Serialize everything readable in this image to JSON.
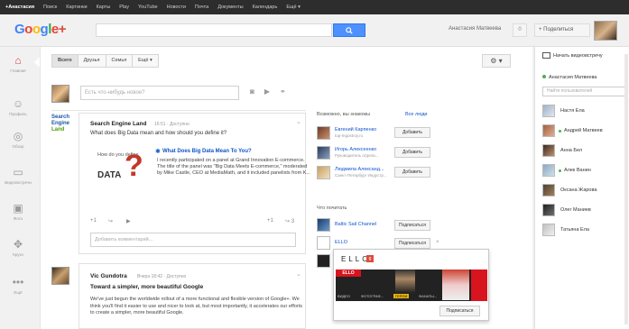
{
  "topbar": {
    "items": [
      {
        "label": "+Анастасия",
        "active": true
      },
      {
        "label": "Поиск"
      },
      {
        "label": "Картинки"
      },
      {
        "label": "Карты"
      },
      {
        "label": "Play"
      },
      {
        "label": "YouTube"
      },
      {
        "label": "Новости"
      },
      {
        "label": "Почта"
      },
      {
        "label": "Документы"
      },
      {
        "label": "Календарь"
      },
      {
        "label": "Ещё ▾"
      }
    ]
  },
  "header": {
    "logo": "Google+",
    "user_name": "Анастасия Матвеева",
    "notifications": "0",
    "share_label": "+ Поделиться"
  },
  "leftnav": {
    "items": [
      {
        "label": "Главная",
        "icon": "home-icon",
        "glyph": "⌂"
      },
      {
        "label": "Профиль",
        "icon": "profile-icon",
        "glyph": "☺"
      },
      {
        "label": "Обзор",
        "icon": "explore-icon",
        "glyph": "◎"
      },
      {
        "label": "Видеовстречи",
        "icon": "hangouts-icon",
        "glyph": "▭"
      },
      {
        "label": "Фото",
        "icon": "photos-icon",
        "glyph": "▣"
      },
      {
        "label": "Круги",
        "icon": "circles-icon",
        "glyph": "✥"
      },
      {
        "label": "Ещё",
        "icon": "more-icon",
        "glyph": "•••"
      }
    ]
  },
  "stream": {
    "tabs": [
      {
        "label": "Всего",
        "active": true
      },
      {
        "label": "Друзья"
      },
      {
        "label": "Семья"
      },
      {
        "label": "Ещё ▾"
      }
    ],
    "gear_label": "⚙ ▾",
    "share_placeholder": "Есть что-нибудь новое?"
  },
  "post1": {
    "logo_lines": [
      "Search",
      "Engine",
      "Land"
    ],
    "author": "Search Engine Land",
    "meta": "16:51 · Доступно",
    "text": "What does Big Data mean and how should you define it?",
    "link": {
      "thumb_how": "How do you define",
      "thumb_data": "DATA",
      "title": "What Does Big Data Mean To You?",
      "desc": "I recently participated on a panel at Grand Innovation E-commerce. The title of the panel was \"Big Data Meets E-commerce,\" moderated by Mike Castle, CEO at MediaMath, and it included panelists from K..."
    },
    "actions": {
      "plus": "+1",
      "share": "↪",
      "video": "▶",
      "plus_count": "+1",
      "share_count": "↪ 3"
    },
    "comment_placeholder": "Добавить комментарий..."
  },
  "post2": {
    "author": "Vic Gundotra",
    "meta": "Вчера 18:42 · Доступно",
    "title": "Toward a simpler, more beautiful Google",
    "text": "We've just begun the worldwide rollout of a more functional and flexible version of Google+. We think you'll find it easier to use and nicer to look at, but most importantly, it accelerates our efforts to create a simpler, more beautiful Google."
  },
  "suggestions": {
    "heading": "Возможно, вы знакомы",
    "see_all": "Все люди",
    "people": [
      {
        "name": "Евгений Карпенко",
        "sub": "top-Ingostroy.ru",
        "button": "Добавить"
      },
      {
        "name": "Игорь Алексеенко",
        "sub": "Руководитель отдела...",
        "button": "Добавить"
      },
      {
        "name": "Людмила Александ...",
        "sub": "Санкт-Петербург Индустр...",
        "button": "Добавить"
      }
    ],
    "read_heading": "Что почитать",
    "pages": [
      {
        "name": "Baltic Sail Channel",
        "button": "Подписаться"
      },
      {
        "name": "ELLO",
        "button": "Подписаться"
      }
    ]
  },
  "hovercard": {
    "title": "ELLO",
    "g_badge": "g",
    "ello_logo": "ELLO",
    "tabs": [
      "ВИДЕО",
      "ФОТОГРАФ...",
      "ГЕРОИ",
      "ФАНАТЫ..."
    ],
    "subscribe": "Подписаться"
  },
  "chat": {
    "hangout_label": "Начать видеовстречу",
    "me": "Анастасия Матвеева",
    "search_placeholder": "Найти пользователей",
    "contacts": [
      "Настя Ела",
      "Андрей Матвеев",
      "Анна Бел",
      "Алек Ванин",
      "Оксана Жарова",
      "Олег Маниев",
      "Татьяна Ела"
    ]
  },
  "colors": {
    "topbar": "#2d2d2d",
    "search_button": "#4d90fe",
    "link": "#1155cc",
    "google_red": "#dd4b39",
    "online": "#4caf50"
  }
}
